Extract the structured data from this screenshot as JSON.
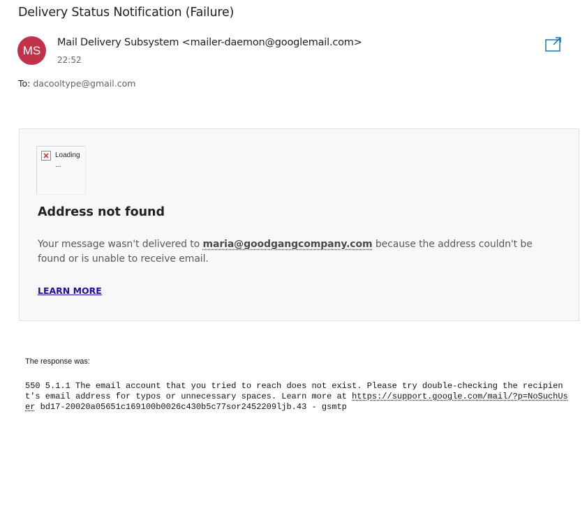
{
  "message": {
    "subject": "Delivery Status Notification (Failure)",
    "avatar_initials": "MS",
    "avatar_color": "#c2334b",
    "sender": "Mail Delivery Subsystem <mailer-daemon@googlemail.com>",
    "time": "22:52",
    "to_label": "To:",
    "to_value": "dacooltype@gmail.com",
    "popout_icon": "open-in-new-window-icon"
  },
  "card": {
    "broken_image_text": "Loading ...",
    "broken_image_icon": "broken-image-icon",
    "title": "Address not found",
    "body_prefix": "Your message wasn't delivered to ",
    "recipient": "maria@goodgangcompany.com",
    "body_suffix": " because the address couldn't be found or is unable to receive email.",
    "learn_more": "LEARN MORE",
    "link_color": "#1a0dab"
  },
  "response": {
    "label": "The response was:",
    "text_before": "550 5.1.1 The email account that you tried to reach does not exist. Please try double-checking the recipient's email address for typos or unnecessary spaces. Learn more at ",
    "url": "https://support.google.com/mail/?p=NoSuchUser",
    "text_after": " bd17-20020a05651c169100b0026c430b5c77sor2452209ljb.43 - gsmtp"
  }
}
